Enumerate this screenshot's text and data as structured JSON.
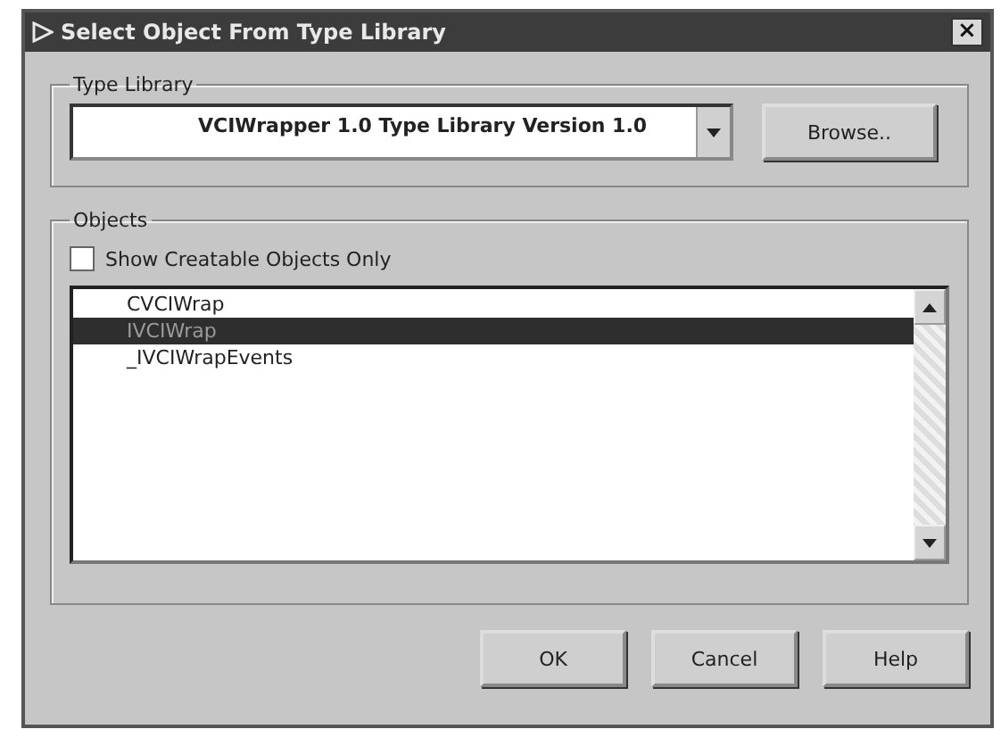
{
  "window": {
    "title": "Select Object From Type Library",
    "close": "×"
  },
  "type_library": {
    "label": "Type Library",
    "value": "VCIWrapper 1.0 Type Library Version 1.0",
    "browse": "Browse.."
  },
  "objects": {
    "label": "Objects",
    "checkbox": {
      "label": "Show Creatable Objects Only",
      "checked": false
    },
    "items": [
      {
        "label": "CVCIWrap",
        "selected": false
      },
      {
        "label": "IVCIWrap",
        "selected": true
      },
      {
        "label": "_IVCIWrapEvents",
        "selected": false
      }
    ]
  },
  "buttons": [
    "OK",
    "Cancel",
    "Help"
  ]
}
